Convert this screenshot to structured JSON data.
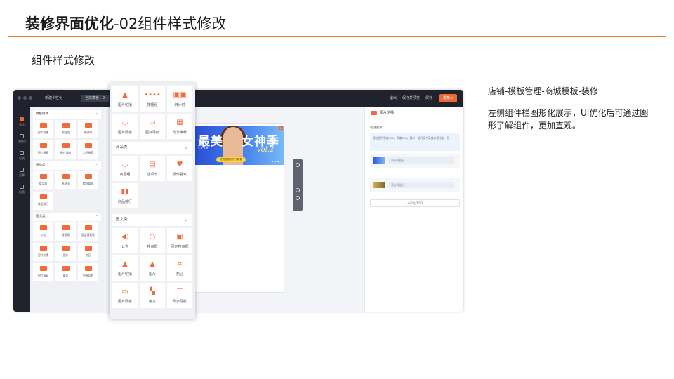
{
  "slide": {
    "title_bold": "装修界面优化",
    "title_rest": "-02组件样式修改",
    "subtitle": "组件样式修改",
    "note_path": "店铺-模板管理-商城模板-装修",
    "note_desc": "左侧组件栏图形化展示，UI优化后可通过图形了解组件，更加直观。",
    "accent": "#ee7d31"
  },
  "app": {
    "shop_name": "新建个性化",
    "template_label": "当前模板：2",
    "top_links": [
      "退出",
      "保存并预览",
      "保存"
    ],
    "publish_label": "发布 ▾",
    "rail": [
      {
        "label": "装修",
        "icon": "brush-icon"
      },
      {
        "label": "店铺页",
        "icon": "page-icon"
      },
      {
        "label": "导航",
        "icon": "nav-icon"
      },
      {
        "label": "页脚",
        "icon": "footer-icon"
      },
      {
        "label": "风格",
        "icon": "style-icon"
      }
    ],
    "panel_sections": [
      {
        "title": "模板组件",
        "items": [
          "图片轮播",
          "按钮组",
          "倒计时",
          "图片橱窗",
          "图片导航",
          "为您推荐"
        ]
      },
      {
        "title": "商品类",
        "items": [
          "商品组",
          "选项卡",
          "猜你喜欢",
          "商品排行"
        ]
      },
      {
        "title": "图文类",
        "items": [
          "公告",
          "搜索框",
          "固定搜索框",
          "图片轮播",
          "图片",
          "热区",
          "图片橱窗",
          "魔方",
          "列表导航"
        ]
      }
    ],
    "banner": {
      "text_left": "最美",
      "text_right": "女神季",
      "date": "3.1-3.8",
      "vol": "vol.2",
      "cta": "抢购品质好货了解更"
    },
    "props": {
      "title": "图片轮播",
      "label": "轮播图片",
      "tip": "建议图片宽度750，高度300。要求一组内图片高度必须完全一致",
      "link_placeholder": "请选择链接",
      "add_label": "+添加 2/10"
    }
  },
  "big_panel": {
    "top_items": [
      {
        "label": "图片轮播",
        "icon": "image-carousel-icon"
      },
      {
        "label": "按钮组",
        "icon": "button-group-icon"
      },
      {
        "label": "倒计时",
        "icon": "countdown-icon"
      },
      {
        "label": "图片橱窗",
        "icon": "image-window-icon"
      },
      {
        "label": "图片导航",
        "icon": "image-nav-icon"
      },
      {
        "label": "为您推荐",
        "icon": "recommend-icon"
      }
    ],
    "goods_title": "商品类",
    "goods_items": [
      {
        "label": "商品组",
        "icon": "goods-group-icon"
      },
      {
        "label": "选项卡",
        "icon": "tabs-icon"
      },
      {
        "label": "猜你喜欢",
        "icon": "heart-icon"
      },
      {
        "label": "商品排行",
        "icon": "ranking-icon"
      }
    ],
    "media_title": "图文类",
    "media_items": [
      {
        "label": "公告",
        "icon": "announcement-icon"
      },
      {
        "label": "搜索框",
        "icon": "search-icon"
      },
      {
        "label": "固定搜索框",
        "icon": "fixed-search-icon"
      },
      {
        "label": "图片轮播",
        "icon": "image-carousel-icon"
      },
      {
        "label": "图片",
        "icon": "image-icon"
      },
      {
        "label": "热区",
        "icon": "hotspot-icon"
      },
      {
        "label": "图片橱窗",
        "icon": "image-window-icon"
      },
      {
        "label": "魔方",
        "icon": "cube-icon"
      },
      {
        "label": "列表导航",
        "icon": "list-nav-icon"
      }
    ]
  }
}
